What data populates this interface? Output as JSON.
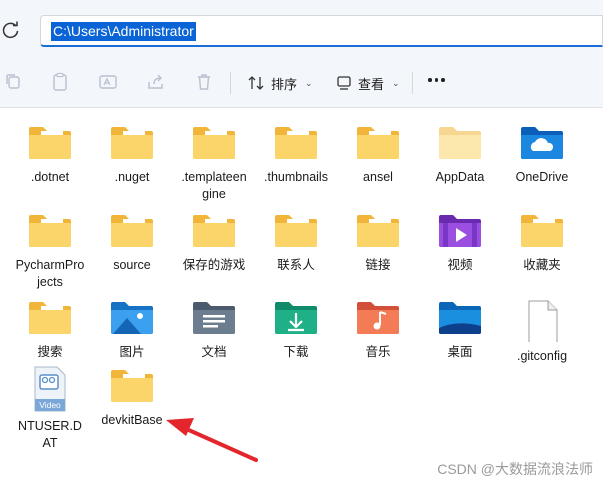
{
  "address_bar": {
    "path": "C:\\Users\\Administrator"
  },
  "toolbar": {
    "sort_label": "排序",
    "view_label": "查看",
    "icons": [
      "copy-icon",
      "paste-icon",
      "rename-icon",
      "share-icon",
      "delete-icon",
      "sort-icon",
      "view-icon",
      "more-icon"
    ]
  },
  "items": [
    {
      "label": ".dotnet",
      "icon": "folder-icon"
    },
    {
      "label": ".nuget",
      "icon": "folder-icon"
    },
    {
      "label": ".templateengine",
      "icon": "folder-icon"
    },
    {
      "label": ".thumbnails",
      "icon": "folder-icon"
    },
    {
      "label": "ansel",
      "icon": "folder-icon"
    },
    {
      "label": "AppData",
      "icon": "folder-hidden-icon"
    },
    {
      "label": "OneDrive",
      "icon": "onedrive-folder-icon"
    },
    {
      "label": "PycharmProjects",
      "icon": "folder-icon"
    },
    {
      "label": "source",
      "icon": "folder-icon"
    },
    {
      "label": "保存的游戏",
      "icon": "folder-icon"
    },
    {
      "label": "联系人",
      "icon": "folder-icon"
    },
    {
      "label": "链接",
      "icon": "folder-icon"
    },
    {
      "label": "视频",
      "icon": "videos-folder-icon"
    },
    {
      "label": "收藏夹",
      "icon": "folder-icon"
    },
    {
      "label": "搜索",
      "icon": "folder-icon"
    },
    {
      "label": "图片",
      "icon": "pictures-folder-icon"
    },
    {
      "label": "文档",
      "icon": "documents-folder-icon"
    },
    {
      "label": "下载",
      "icon": "downloads-folder-icon"
    },
    {
      "label": "音乐",
      "icon": "music-folder-icon"
    },
    {
      "label": "桌面",
      "icon": "desktop-folder-icon"
    },
    {
      "label": ".gitconfig",
      "icon": "file-icon"
    },
    {
      "label": "NTUSER.DAT",
      "icon": "video-file-icon"
    },
    {
      "label": "devkitBase",
      "icon": "folder-icon"
    }
  ],
  "video_badge": "Video",
  "watermark": "CSDN @大数据流浪法师",
  "colors": {
    "accent": "#0a64d6",
    "folder": "#f8c84a",
    "arrow": "#e3262b"
  }
}
